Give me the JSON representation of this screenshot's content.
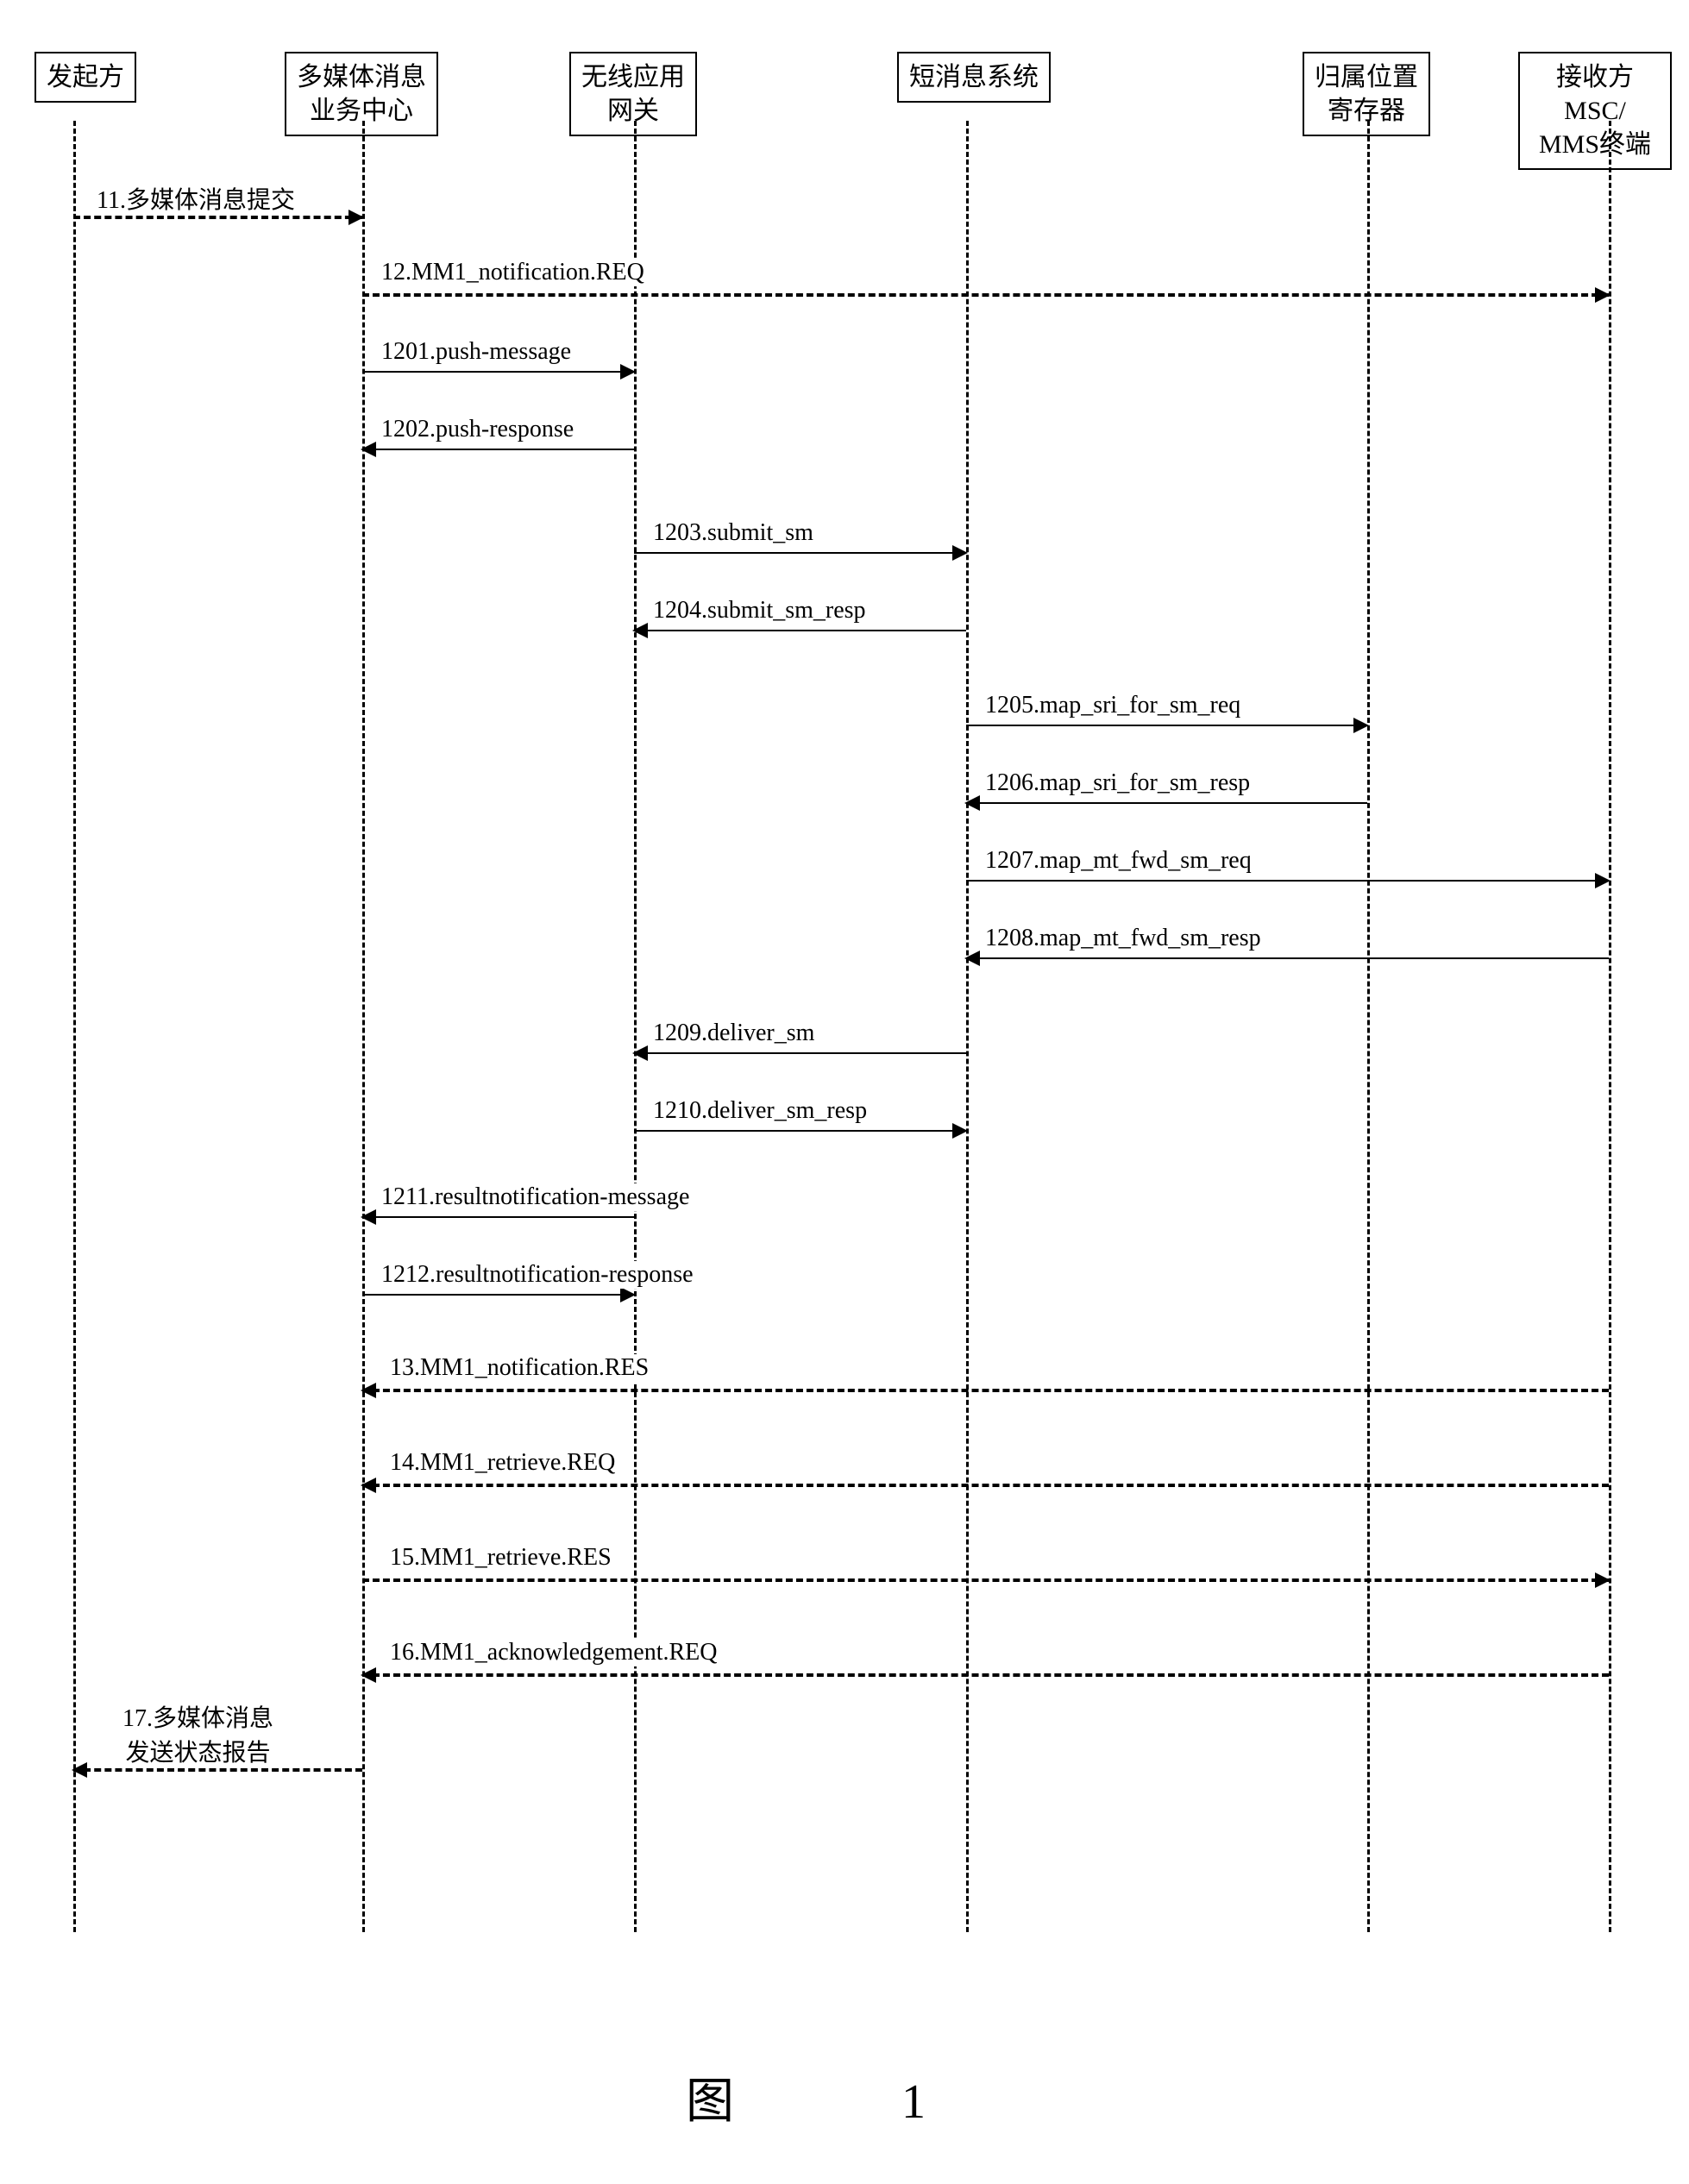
{
  "participants": {
    "p1": "发起方",
    "p2": "多媒体消息\n业务中心",
    "p3": "无线应用\n网关",
    "p4": "短消息系统",
    "p5": "归属位置\n寄存器",
    "p6": "接收方MSC/\nMMS终端"
  },
  "messages": {
    "m11": "11.多媒体消息提交",
    "m12": "12.MM1_notification.REQ",
    "m1201": "1201.push-message",
    "m1202": "1202.push-response",
    "m1203": "1203.submit_sm",
    "m1204": "1204.submit_sm_resp",
    "m1205": "1205.map_sri_for_sm_req",
    "m1206": "1206.map_sri_for_sm_resp",
    "m1207": "1207.map_mt_fwd_sm_req",
    "m1208": "1208.map_mt_fwd_sm_resp",
    "m1209": "1209.deliver_sm",
    "m1210": "1210.deliver_sm_resp",
    "m1211": "1211.resultnotification-message",
    "m1212": "1212.resultnotification-response",
    "m13": "13.MM1_notification.RES",
    "m14": "14.MM1_retrieve.REQ",
    "m15": "15.MM1_retrieve.RES",
    "m16": "16.MM1_acknowledgement.REQ",
    "m17": "17.多媒体消息\n发送状态报告"
  },
  "figure_label": "图 1",
  "chart_data": {
    "type": "sequence_diagram",
    "participants": [
      "发起方",
      "多媒体消息业务中心",
      "无线应用网关",
      "短消息系统",
      "归属位置寄存器",
      "接收方MSC/MMS终端"
    ],
    "messages": [
      {
        "id": "11",
        "from": "发起方",
        "to": "多媒体消息业务中心",
        "label": "多媒体消息提交",
        "style": "dashed"
      },
      {
        "id": "12",
        "from": "多媒体消息业务中心",
        "to": "接收方MSC/MMS终端",
        "label": "MM1_notification.REQ",
        "style": "dashed"
      },
      {
        "id": "1201",
        "from": "多媒体消息业务中心",
        "to": "无线应用网关",
        "label": "push-message",
        "style": "solid"
      },
      {
        "id": "1202",
        "from": "无线应用网关",
        "to": "多媒体消息业务中心",
        "label": "push-response",
        "style": "solid"
      },
      {
        "id": "1203",
        "from": "无线应用网关",
        "to": "短消息系统",
        "label": "submit_sm",
        "style": "solid"
      },
      {
        "id": "1204",
        "from": "短消息系统",
        "to": "无线应用网关",
        "label": "submit_sm_resp",
        "style": "solid"
      },
      {
        "id": "1205",
        "from": "短消息系统",
        "to": "归属位置寄存器",
        "label": "map_sri_for_sm_req",
        "style": "solid"
      },
      {
        "id": "1206",
        "from": "归属位置寄存器",
        "to": "短消息系统",
        "label": "map_sri_for_sm_resp",
        "style": "solid"
      },
      {
        "id": "1207",
        "from": "短消息系统",
        "to": "接收方MSC/MMS终端",
        "label": "map_mt_fwd_sm_req",
        "style": "solid"
      },
      {
        "id": "1208",
        "from": "接收方MSC/MMS终端",
        "to": "短消息系统",
        "label": "map_mt_fwd_sm_resp",
        "style": "solid"
      },
      {
        "id": "1209",
        "from": "短消息系统",
        "to": "无线应用网关",
        "label": "deliver_sm",
        "style": "solid"
      },
      {
        "id": "1210",
        "from": "无线应用网关",
        "to": "短消息系统",
        "label": "deliver_sm_resp",
        "style": "solid"
      },
      {
        "id": "1211",
        "from": "无线应用网关",
        "to": "多媒体消息业务中心",
        "label": "resultnotification-message",
        "style": "solid"
      },
      {
        "id": "1212",
        "from": "多媒体消息业务中心",
        "to": "无线应用网关",
        "label": "resultnotification-response",
        "style": "solid"
      },
      {
        "id": "13",
        "from": "接收方MSC/MMS终端",
        "to": "多媒体消息业务中心",
        "label": "MM1_notification.RES",
        "style": "dashed"
      },
      {
        "id": "14",
        "from": "接收方MSC/MMS终端",
        "to": "多媒体消息业务中心",
        "label": "MM1_retrieve.REQ",
        "style": "dashed"
      },
      {
        "id": "15",
        "from": "多媒体消息业务中心",
        "to": "接收方MSC/MMS终端",
        "label": "MM1_retrieve.RES",
        "style": "dashed"
      },
      {
        "id": "16",
        "from": "接收方MSC/MMS终端",
        "to": "多媒体消息业务中心",
        "label": "MM1_acknowledgement.REQ",
        "style": "dashed"
      },
      {
        "id": "17",
        "from": "多媒体消息业务中心",
        "to": "发起方",
        "label": "多媒体消息发送状态报告",
        "style": "dashed"
      }
    ]
  }
}
